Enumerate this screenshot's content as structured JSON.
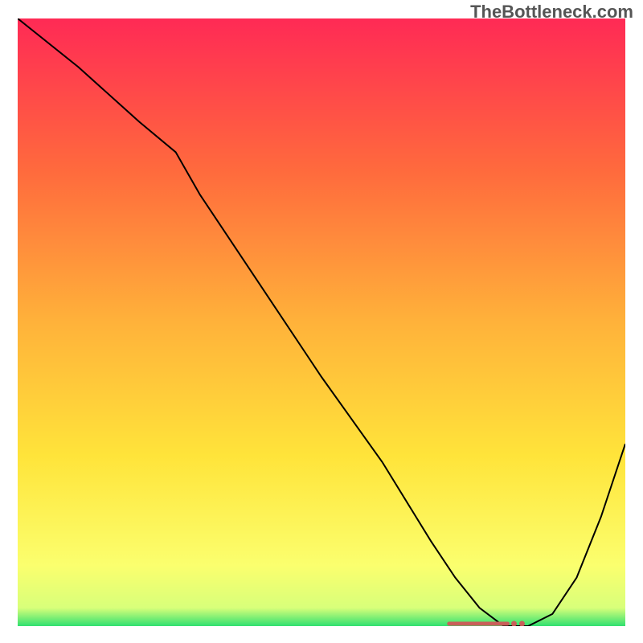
{
  "watermark": "TheBottleneck.com",
  "chart_data": {
    "type": "line",
    "title": "",
    "xlabel": "",
    "ylabel": "",
    "xlim": [
      0,
      100
    ],
    "ylim": [
      0,
      100
    ],
    "grid": false,
    "legend": false,
    "series": [
      {
        "name": "curve",
        "x": [
          0,
          10,
          20,
          26,
          30,
          40,
          50,
          60,
          68,
          72,
          76,
          80,
          84,
          88,
          92,
          96,
          100
        ],
        "y": [
          100,
          92,
          83,
          78,
          71,
          56,
          41,
          27,
          14,
          8,
          3,
          0,
          0,
          2,
          8,
          18,
          30
        ]
      }
    ],
    "minimum_region": {
      "x_start": 71,
      "x_end": 83
    },
    "gradient_stops": [
      {
        "offset": 0.0,
        "color": "#ff2a55"
      },
      {
        "offset": 0.25,
        "color": "#ff6a3d"
      },
      {
        "offset": 0.5,
        "color": "#ffb23a"
      },
      {
        "offset": 0.72,
        "color": "#ffe43a"
      },
      {
        "offset": 0.9,
        "color": "#fbff6e"
      },
      {
        "offset": 0.97,
        "color": "#d8ff7a"
      },
      {
        "offset": 1.0,
        "color": "#30e070"
      }
    ]
  }
}
